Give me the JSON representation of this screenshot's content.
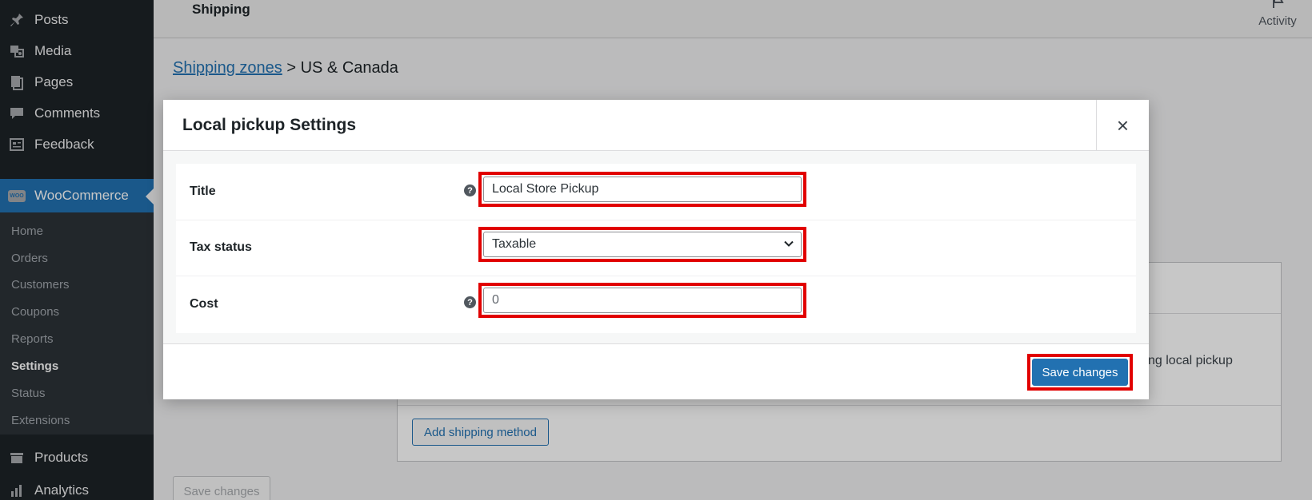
{
  "sidebar": {
    "items": [
      {
        "label": "Posts",
        "icon": "pin-icon"
      },
      {
        "label": "Media",
        "icon": "media-icon"
      },
      {
        "label": "Pages",
        "icon": "pages-icon"
      },
      {
        "label": "Comments",
        "icon": "comment-icon"
      },
      {
        "label": "Feedback",
        "icon": "feedback-icon"
      },
      {
        "label": "WooCommerce",
        "icon": "woocommerce-icon"
      }
    ],
    "submenu": [
      "Home",
      "Orders",
      "Customers",
      "Coupons",
      "Reports",
      "Settings",
      "Status",
      "Extensions"
    ],
    "submenu_current": "Settings",
    "bottom_items": [
      {
        "label": "Products",
        "icon": "products-icon"
      },
      {
        "label": "Analytics",
        "icon": "analytics-icon"
      }
    ]
  },
  "header": {
    "title": "Shipping",
    "activity_label": "Activity"
  },
  "breadcrumb": {
    "link": "Shipping zones",
    "separator": ">",
    "current": "US & Canada"
  },
  "background_panel": {
    "description_fragment": "ng local pickup",
    "add_method_label": "Add shipping method",
    "save_label": "Save changes"
  },
  "modal": {
    "title": "Local pickup Settings",
    "close_glyph": "×",
    "fields": {
      "title": {
        "label": "Title",
        "value": "Local Store Pickup"
      },
      "tax_status": {
        "label": "Tax status",
        "value": "Taxable"
      },
      "cost": {
        "label": "Cost",
        "placeholder": "0"
      }
    },
    "help_glyph": "?",
    "save_label": "Save changes"
  },
  "colors": {
    "accent": "#2271b1",
    "highlight": "#e10000",
    "sidebar_bg": "#1d2327"
  }
}
